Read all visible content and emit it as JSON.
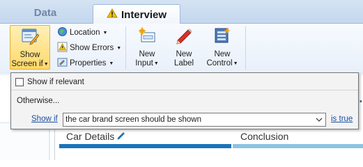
{
  "tabs": [
    {
      "label": "Data",
      "active": false
    },
    {
      "label": "Interview",
      "active": true,
      "icon": "warning-icon"
    }
  ],
  "ribbon": {
    "show_screen_if": {
      "line1": "Show",
      "line2": "Screen if",
      "icon": "screen-condition-icon"
    },
    "small_buttons": [
      {
        "label": "Location",
        "icon": "location-icon"
      },
      {
        "label": "Show Errors",
        "icon": "error-warning-icon"
      },
      {
        "label": "Properties",
        "icon": "properties-icon"
      }
    ],
    "new_input": {
      "line1": "New",
      "line2": "Input",
      "icon": "new-input-icon"
    },
    "new_label": {
      "line1": "New",
      "line2": "Label",
      "icon": "pencil-icon"
    },
    "new_control": {
      "line1": "New",
      "line2": "Control",
      "icon": "new-control-icon"
    }
  },
  "popup": {
    "checkbox_label": "Show if relevant",
    "checkbox_checked": false,
    "otherwise_label": "Otherwise...",
    "show_if_link": "Show if",
    "condition_value": "the car brand screen should be shown",
    "is_true_link": "is true"
  },
  "stages": [
    {
      "label": "Car Details",
      "icon": "edit-pencil-icon",
      "color": "#1b73b9"
    },
    {
      "label": "Conclusion",
      "color": "#8cc3e3"
    }
  ],
  "colors": {
    "accent_blue": "#1b73b9",
    "light_blue": "#8cc3e3",
    "ribbon_active": "#ffd868",
    "link": "#1a4fa0"
  }
}
